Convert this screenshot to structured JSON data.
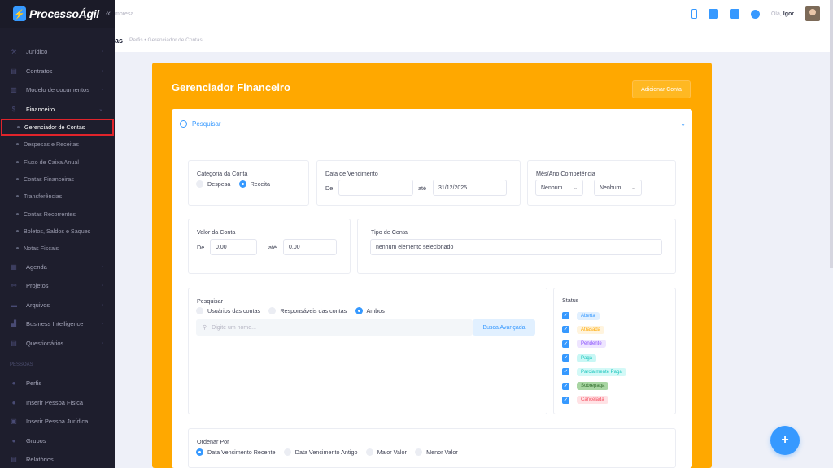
{
  "brand": {
    "name": "ProcessoÁgil",
    "collapse_icon": "double-chevron-left-icon"
  },
  "header": {
    "company_placeholder": "mpresa",
    "greeting": "Olá,",
    "user": "Igor"
  },
  "subheader": {
    "title": "as",
    "breadcrumb": "Perfis • Gerenciador de Contas"
  },
  "sidebar": {
    "top_faded": "",
    "items": [
      {
        "label": "Jurídico",
        "icon": "gavel-icon"
      },
      {
        "label": "Contratos",
        "icon": "document-icon"
      },
      {
        "label": "Modelo de documentos",
        "icon": "file-icon"
      },
      {
        "label": "Financeiro",
        "icon": "dollar-icon"
      }
    ],
    "sub_items": [
      "Gerenciador de Contas",
      "Despesas e Receitas",
      "Fluxo de Caixa Anual",
      "Contas Financeiras",
      "Transferências",
      "Contas Recorrentes",
      "Boletos, Saldos e Saques",
      "Notas Fiscais"
    ],
    "items2": [
      {
        "label": "Agenda",
        "icon": "calendar-icon"
      },
      {
        "label": "Projetos",
        "icon": "project-icon"
      },
      {
        "label": "Arquivos",
        "icon": "folder-icon"
      },
      {
        "label": "Business Intelligence",
        "icon": "chart-icon"
      },
      {
        "label": "Questionários",
        "icon": "questionnaire-icon"
      }
    ],
    "section_pessoas": "PESSOAS",
    "items3": [
      {
        "label": "Perfis",
        "icon": "user-icon"
      },
      {
        "label": "Inserir Pessoa Física",
        "icon": "user-add-icon"
      },
      {
        "label": "Inserir Pessoa Jurídica",
        "icon": "building-icon"
      },
      {
        "label": "Grupos",
        "icon": "group-icon"
      },
      {
        "label": "Relatórios",
        "icon": "report-icon"
      }
    ]
  },
  "main": {
    "title": "Gerenciador Financeiro",
    "add_button": "Adicionar Conta",
    "search_label": "Pesquisar",
    "categoria": {
      "label": "Categoria da Conta",
      "opt1": "Despesa",
      "opt2": "Receita"
    },
    "vencimento": {
      "label": "Data de Vencimento",
      "de": "De",
      "ate": "até",
      "to_value": "31/12/2025"
    },
    "competencia": {
      "label": "Mês/Ano Competência",
      "month": "Nenhum",
      "year": "Nenhum"
    },
    "valor": {
      "label": "Valor da Conta",
      "de": "De",
      "ate": "até",
      "from_value": "0,00",
      "to_value": "0,00"
    },
    "tipo": {
      "label": "Tipo de Conta",
      "value": "nenhum elemento selecionado"
    },
    "pesquisar": {
      "label": "Pesquisar",
      "opt1": "Usuários das contas",
      "opt2": "Responsáveis das contas",
      "opt3": "Ambos",
      "placeholder": "Digite um nome...",
      "advanced": "Busca Avançada"
    },
    "status": {
      "label": "Status",
      "items": [
        {
          "label": "Aberta",
          "bg": "#e1f0ff",
          "fg": "#3699ff"
        },
        {
          "label": "Atrasada",
          "bg": "#fff4de",
          "fg": "#ffa800"
        },
        {
          "label": "Pendente",
          "bg": "#eee5ff",
          "fg": "#8950fc"
        },
        {
          "label": "Paga",
          "bg": "#c9f7f5",
          "fg": "#1bc5bd"
        },
        {
          "label": "Parcialmente Paga",
          "bg": "#d3f9f7",
          "fg": "#1bc5bd"
        },
        {
          "label": "Sobrepaga",
          "bg": "#a8d5a2",
          "fg": "#2e6b2a"
        },
        {
          "label": "Cancelada",
          "bg": "#ffe2e5",
          "fg": "#f64e60"
        }
      ]
    },
    "ordenar": {
      "label": "Ordenar Por",
      "opt1": "Data Vencimento Recente",
      "opt2": "Data Vencimento Antigo",
      "opt3": "Maior Valor",
      "opt4": "Menor Valor"
    }
  },
  "fab_label": "+"
}
